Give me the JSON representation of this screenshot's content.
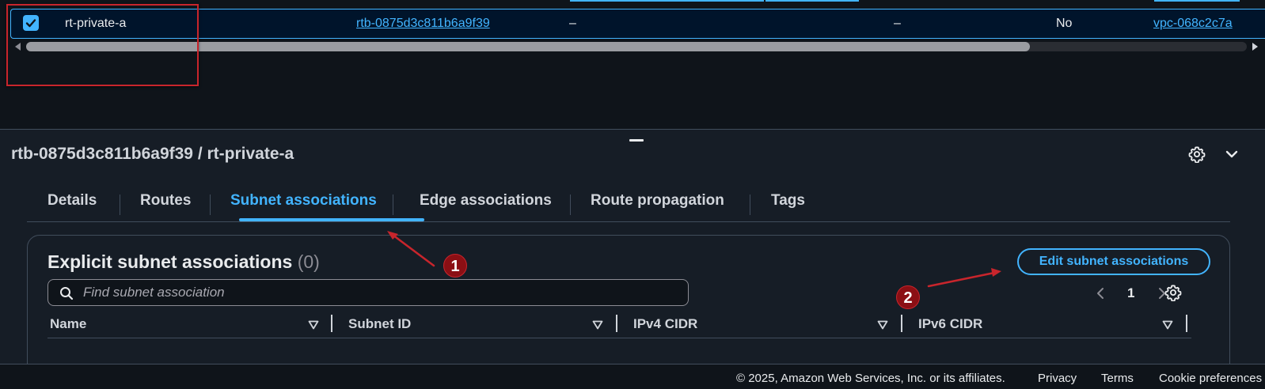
{
  "table": {
    "selected_row": {
      "name": "rt-private-a",
      "route_table_id": "rtb-0875d3c811b6a9f39",
      "col3": "–",
      "col4": "–",
      "main": "No",
      "vpc": "vpc-068c2c7a"
    }
  },
  "panel": {
    "title": "rtb-0875d3c811b6a9f39 / rt-private-a",
    "tabs": [
      "Details",
      "Routes",
      "Subnet associations",
      "Edge associations",
      "Route propagation",
      "Tags"
    ],
    "active_tab": "Subnet associations"
  },
  "subnet_section": {
    "title": "Explicit subnet associations",
    "count": "(0)",
    "edit_button": "Edit subnet associations",
    "search_placeholder": "Find subnet association",
    "page": "1",
    "columns": [
      "Name",
      "Subnet ID",
      "IPv4 CIDR",
      "IPv6 CIDR"
    ]
  },
  "annotations": {
    "badge_1": "1",
    "badge_2": "2",
    "colors": {
      "annotation_red": "#c8252c",
      "badge_fill": "#8b0f14"
    }
  },
  "footer": {
    "copyright": "© 2025, Amazon Web Services, Inc. or its affiliates.",
    "privacy": "Privacy",
    "terms": "Terms",
    "cookies": "Cookie preferences"
  },
  "colors": {
    "accent": "#42b4ff",
    "background": "#0f141a",
    "panel": "#161d26"
  }
}
